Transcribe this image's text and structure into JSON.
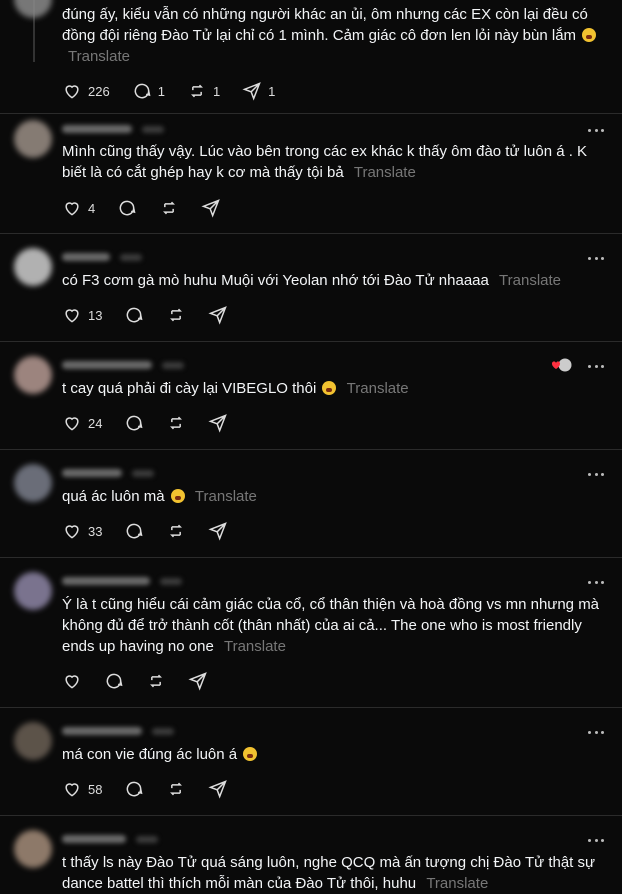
{
  "translate_label": "Translate",
  "posts": [
    {
      "text": "đúng ấy, kiểu vẫn có những người khác an ủi, ôm nhưng các EX còn lại đều có đồng đội riêng Đào Tử lại chỉ có 1 mình. Cảm giác cô đơn len lỏi này bùn lắm",
      "likes": "226",
      "replies": "1",
      "reposts": "1",
      "shares": "1"
    },
    {
      "text": "Mình cũng thấy vậy. Lúc vào bên trong các ex khác k thấy ôm đào tử luôn á . K biết là có cắt ghép hay k cơ mà thấy tội bả",
      "likes": "4"
    },
    {
      "text": "có F3 cơm gà mò huhu Muội với Yeolan nhớ tới Đào Tử nhaaaa",
      "likes": "13"
    },
    {
      "text": "t cay quá phải đi cày lại VIBEGLO thôi",
      "likes": "24"
    },
    {
      "text": "quá ác luôn mà",
      "likes": "33"
    },
    {
      "text": "Ý là t cũng hiểu cái cảm giác của cổ, cổ thân thiện và hoà đồng vs mn nhưng mà không đủ để trở thành cốt (thân nhất) của ai cả... The one who is most friendly ends up having no one",
      "likes": ""
    },
    {
      "text": "má con vie đúng ác luôn á",
      "likes": "58"
    },
    {
      "text": "t thấy ls này Đào Tử quá sáng luôn, nghe QCQ mà ấn tượng chị Đào Tử thật sự dance battel thì thích mỗi màn của Đào Tử thôi, huhu"
    }
  ]
}
